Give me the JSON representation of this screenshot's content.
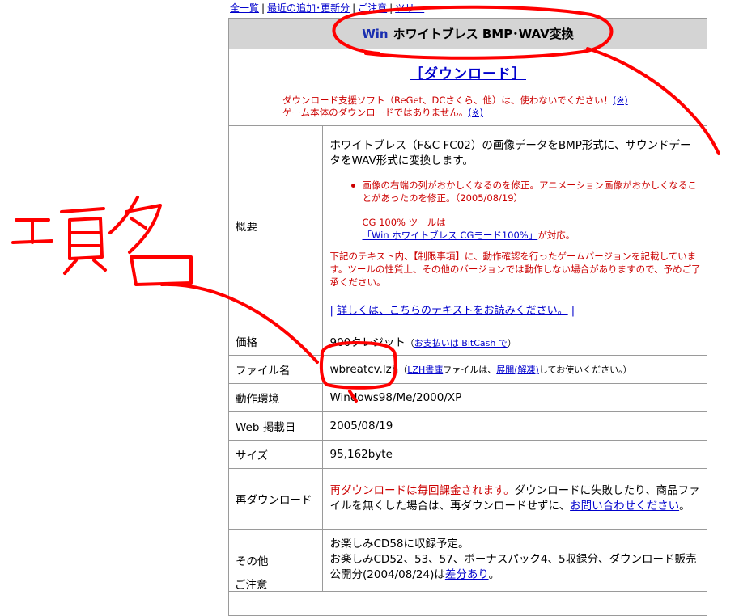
{
  "topnav": [
    {
      "label": "全一覧"
    },
    {
      "label": "最近の追加･更新分"
    },
    {
      "label": "ご注意"
    },
    {
      "label": "ツリー"
    }
  ],
  "title": {
    "prefix": "Win",
    "text": "ホワイトブレス BMP･WAV変換"
  },
  "download": {
    "link_label": "［ダウンロード］",
    "note1": "ダウンロード支援ソフト（ReGet、DCさくら、他）は、使わないでください！",
    "note1_link": "(※)",
    "note2": "ゲーム本体のダウンロードではありません。",
    "note2_link": "(※)"
  },
  "rows": {
    "overview": {
      "label": "概要",
      "desc": "ホワイトブレス（F&C FC02）の画像データをBMP形式に、サウンドデータをWAV形式に変換します。",
      "bullet": "画像の右端の列がおかしくなるのを修正。アニメーション画像がおかしくなることがあったのを修正。（2005/08/19）",
      "cg_line": "CG 100% ツールは",
      "cg_link": "「Win ホワイトブレス CGモード100%」",
      "cg_suffix": "が対応。",
      "limit": "下記のテキスト内、【制限事項】に、動作確認を行ったゲームバージョンを記載しています。ツールの性質上、その他のバージョンでは動作しない場合がありますので、予めご了承ください。",
      "more_link": "詳しくは、こちらのテキストをお読みください。"
    },
    "price": {
      "label": "価格",
      "value": "900クレジット",
      "paren_open": "（",
      "pay_link": "お支払いは BitCash で",
      "paren_close": "）"
    },
    "filename": {
      "label": "ファイル名",
      "value": "wbreatcv.lzh",
      "h_open": "（",
      "lzh_link": "LZH書庫",
      "h_mid": "ファイルは、",
      "extract_link": "展開(解凍)",
      "h_end": "してお使いください。）"
    },
    "env": {
      "label": "動作環境",
      "value": "Windows98/Me/2000/XP"
    },
    "date": {
      "label": "Web 掲載日",
      "value": "2005/08/19"
    },
    "size": {
      "label": "サイズ",
      "value": "95,162byte"
    },
    "redownload": {
      "label": "再ダウンロード",
      "red": "再ダウンロードは毎回課金されます。",
      "text": "ダウンロードに失敗したり、商品ファイルを無くした場合は、再ダウンロードせずに、",
      "link": "お問い合わせください",
      "end": "。"
    },
    "other": {
      "label": "その他",
      "line1": "お楽しみCD58に収録予定。",
      "line2": "お楽しみCD52、53、57、ボーナスパック4、5収録分、ダウンロード販売公開分(2004/08/24)は",
      "link": "差分あり",
      "end": "。"
    }
  },
  "notice": {
    "label": "ご注意"
  },
  "annotation": {
    "text": "項名"
  },
  "colors": {
    "link": "#0000cc",
    "warning": "#cc0000",
    "header_bg": "#d4d4d4",
    "marker": "#ff0000"
  }
}
